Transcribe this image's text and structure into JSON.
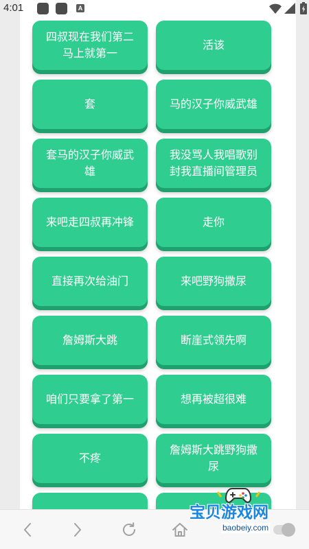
{
  "status_bar": {
    "time": "4:01",
    "notification_letter": "A",
    "icons": [
      "app-notification-icon",
      "app-notification-icon",
      "a-notification-icon",
      "wifi-icon",
      "signal-icon",
      "battery-charging-icon"
    ]
  },
  "colors": {
    "button_face": "#2fcd8f",
    "button_edge": "#20a06f",
    "button_text": "#ffffff",
    "page_side": "#ececec",
    "page_center": "#ffffff",
    "status_icon": "#4b4b4b",
    "nav_icon": "#a0a0a0",
    "watermark_blue": "#1a86e0"
  },
  "buttons": [
    {
      "label": "四叔现在我们第二马上就第一"
    },
    {
      "label": "活该"
    },
    {
      "label": "套"
    },
    {
      "label": "马的汉子你威武雄"
    },
    {
      "label": "套马的汉子你威武雄"
    },
    {
      "label": "我没骂人我唱歌别封我直播间管理员"
    },
    {
      "label": "来吧走四叔再冲锋"
    },
    {
      "label": "走你"
    },
    {
      "label": "直接再次给油门"
    },
    {
      "label": "来吧野狗撒尿"
    },
    {
      "label": "詹姆斯大跳"
    },
    {
      "label": "断崖式领先啊"
    },
    {
      "label": "咱们只要拿了第一"
    },
    {
      "label": "想再被超很难"
    },
    {
      "label": "不疼"
    },
    {
      "label": "詹姆斯大跳野狗撒尿"
    }
  ],
  "bottom_nav": {
    "items": [
      {
        "icon": "back-chevron-icon"
      },
      {
        "icon": "forward-chevron-icon"
      },
      {
        "icon": "refresh-icon"
      },
      {
        "icon": "home-icon"
      },
      {
        "icon": "toggle-switch"
      }
    ]
  },
  "watermark": {
    "name": "宝贝游戏网",
    "domain": "baobeiy.com",
    "icon": "game-controller-icon"
  }
}
